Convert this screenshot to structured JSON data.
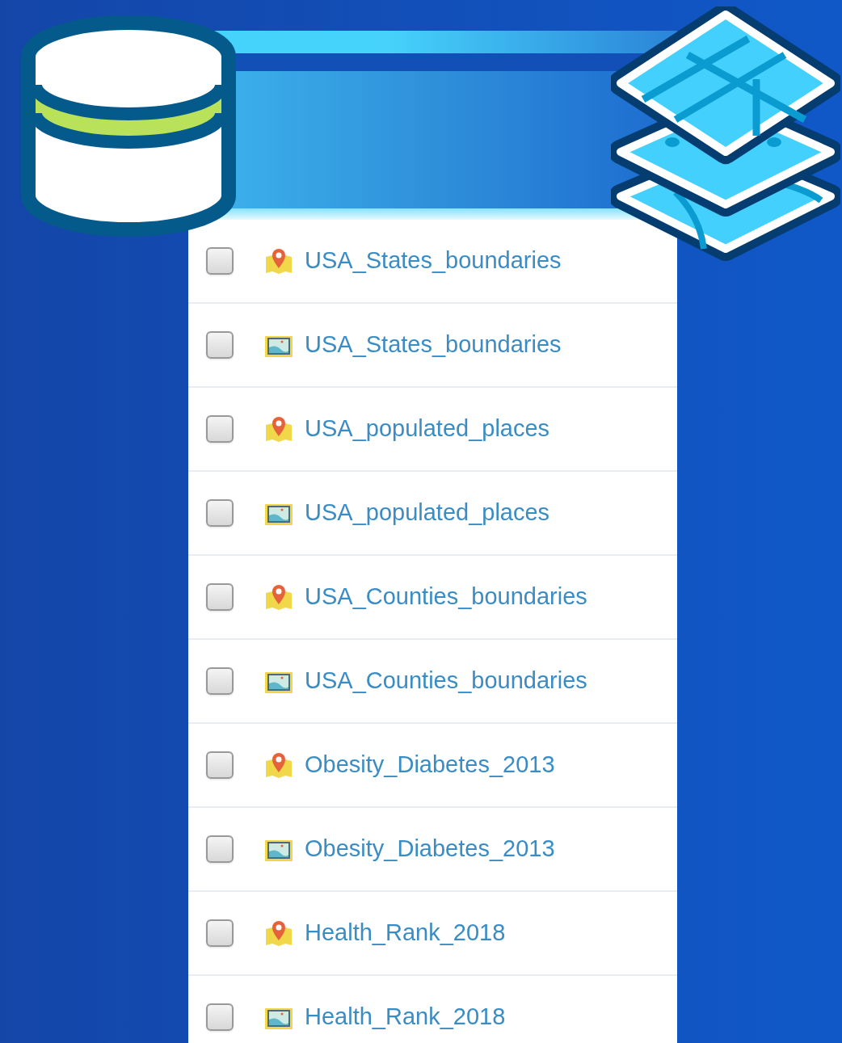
{
  "layers": [
    {
      "label": "USA_States_boundaries",
      "kind": "pin",
      "checked": false
    },
    {
      "label": "USA_States_boundaries",
      "kind": "map",
      "checked": false
    },
    {
      "label": "USA_populated_places",
      "kind": "pin",
      "checked": false
    },
    {
      "label": "USA_populated_places",
      "kind": "map",
      "checked": false
    },
    {
      "label": "USA_Counties_boundaries",
      "kind": "pin",
      "checked": false
    },
    {
      "label": "USA_Counties_boundaries",
      "kind": "map",
      "checked": false
    },
    {
      "label": "Obesity_Diabetes_2013",
      "kind": "pin",
      "checked": false
    },
    {
      "label": "Obesity_Diabetes_2013",
      "kind": "map",
      "checked": false
    },
    {
      "label": "Health_Rank_2018",
      "kind": "pin",
      "checked": false
    },
    {
      "label": "Health_Rank_2018",
      "kind": "map",
      "checked": false
    }
  ]
}
